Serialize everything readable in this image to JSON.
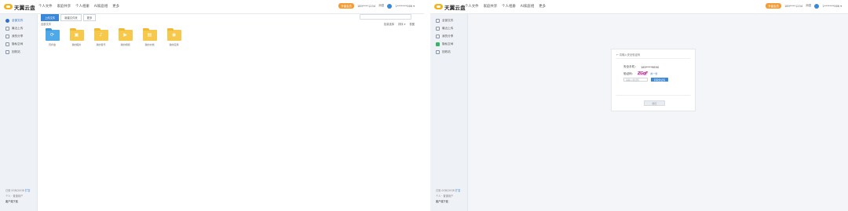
{
  "brand": {
    "name": "天翼云盘"
  },
  "nav": [
    "个人文件",
    "家庭共享",
    "个人相册",
    "AI家庭相",
    "更多"
  ],
  "user": {
    "badge": "升级会员",
    "phone": "189****1234",
    "msg": "消息",
    "account": "1*******566 ▾"
  },
  "sidebar": {
    "items": [
      {
        "label": "全部文件",
        "icon": "folder-icon"
      },
      {
        "label": "最近上传",
        "icon": "clock-icon"
      },
      {
        "label": "我的分享",
        "icon": "share-icon"
      },
      {
        "label": "隐私空间",
        "icon": "lock-icon"
      },
      {
        "label": "回收站",
        "icon": "trash-icon"
      }
    ],
    "storage": "已用 0GB/20GB",
    "storage_link": "扩容",
    "vip": "个人 · 普通用户",
    "download": "客户端下载"
  },
  "main": {
    "tabs": [
      "上传文件",
      "新建文件夹",
      "更多"
    ],
    "breadcrumb": "全部文件",
    "toolbar": {
      "select": "批量选择",
      "sort": "排序 ▾",
      "view": "视图"
    },
    "files": [
      {
        "name": "同步盘",
        "icon": "sync-folder-icon",
        "color": "blue"
      },
      {
        "name": "我的图片",
        "icon": "image-folder-icon",
        "color": "yellow"
      },
      {
        "name": "我的音乐",
        "icon": "music-folder-icon",
        "color": "yellow"
      },
      {
        "name": "我的视频",
        "icon": "video-folder-icon",
        "color": "yellow"
      },
      {
        "name": "我的文档",
        "icon": "document-folder-icon",
        "color": "yellow"
      },
      {
        "name": "我的应用",
        "icon": "app-folder-icon",
        "color": "yellow"
      }
    ]
  },
  "dialog": {
    "title": "← 请输入安全验证码",
    "phone_label": "安全手机：",
    "phone_value": "189****9890",
    "code_label": "验证码：",
    "captcha_text": "ZGqF",
    "refresh": "换一张",
    "input_placeholder": "请输入验证码",
    "send_button": "获取验证码",
    "confirm_button": "确定"
  },
  "colors": {
    "accent": "#3a86d8",
    "badge": "#f39c33",
    "folder": "#f6c94d"
  }
}
